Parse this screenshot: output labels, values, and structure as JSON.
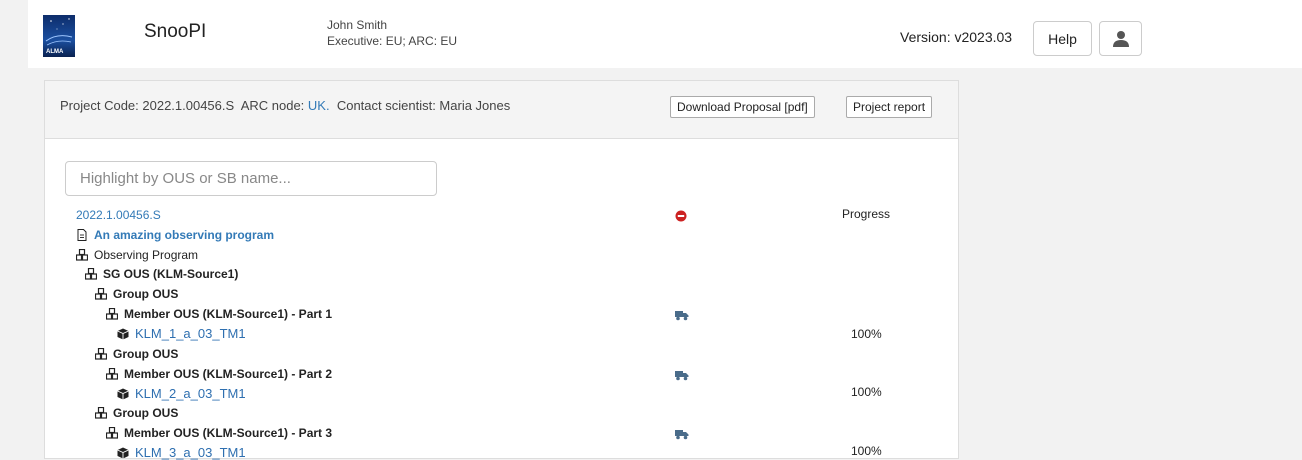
{
  "header": {
    "app_name": "SnooPI",
    "user_name": "John Smith",
    "user_role": "Executive: EU; ARC: EU",
    "version": "Version: v2023.03",
    "help_label": "Help",
    "logo_text": "ALMA"
  },
  "project": {
    "code_label": "Project Code: 2022.1.00456.S",
    "arc_label": "ARC node:",
    "arc_value": "UK.",
    "contact": "Contact scientist: Maria Jones",
    "download_label": "Download Proposal [pdf]",
    "report_label": "Project report"
  },
  "search": {
    "placeholder": "Highlight by OUS or SB name..."
  },
  "tree": {
    "project_code": "2022.1.00456.S",
    "proposal_title": "An amazing observing program",
    "observing_program": "Observing Program",
    "sg_ous": "SG OUS (KLM-Source1)",
    "group_ous": "Group OUS",
    "member_1": "Member OUS (KLM-Source1) - Part 1",
    "sb_1": "KLM_1_a_03_TM1",
    "member_2": "Member OUS (KLM-Source1) - Part 2",
    "sb_2": "KLM_2_a_03_TM1",
    "member_3": "Member OUS (KLM-Source1) - Part 3",
    "sb_3": "KLM_3_a_03_TM1",
    "progress_header": "Progress",
    "progress_1": "100%",
    "progress_2": "100%",
    "progress_3": "100%"
  },
  "colors": {
    "link": "#337ab7",
    "status_red": "#cc2222",
    "truck_blue": "#4a6c8a"
  }
}
